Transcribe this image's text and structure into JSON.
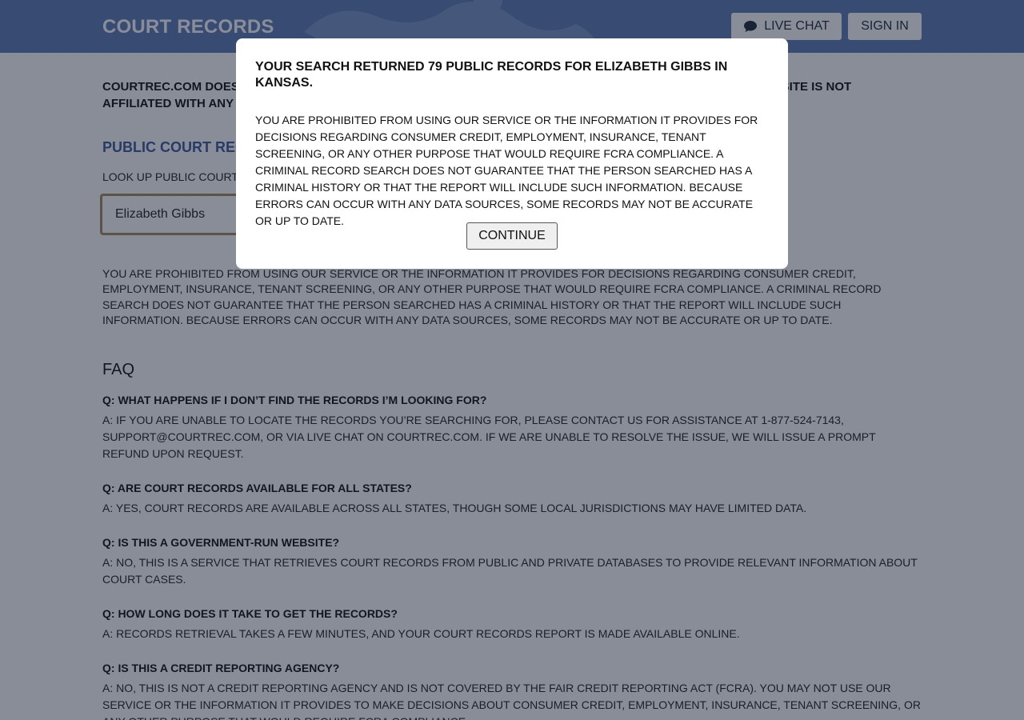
{
  "header": {
    "logo": "COURT RECORDS",
    "live_chat_label": "LIVE CHAT",
    "sign_in_label": "SIGN IN"
  },
  "notice": "COURTREC.COM DOES NOT PROVIDE CONSUMER REPORTS AND IS NOT A CONSUMER REPORTING AGENCY. THIS SITE IS NOT AFFILIATED WITH ANY GOVERNMENT AFFILIATED AGENCY OR CONSUMER REPORTING AGENCY.",
  "search": {
    "section_title": "PUBLIC COURT RECORDS SEARCH",
    "label": "LOOK UP PUBLIC COURTHOUSE RECORDS",
    "value": "Elizabeth Gibbs"
  },
  "disclaimer": "YOU ARE PROHIBITED FROM USING OUR SERVICE OR THE INFORMATION IT PROVIDES FOR DECISIONS REGARDING CONSUMER CREDIT, EMPLOYMENT, INSURANCE, TENANT SCREENING, OR ANY OTHER PURPOSE THAT WOULD REQUIRE FCRA COMPLIANCE. A CRIMINAL RECORD SEARCH DOES NOT GUARANTEE THAT THE PERSON SEARCHED HAS A CRIMINAL HISTORY OR THAT THE REPORT WILL INCLUDE SUCH INFORMATION. BECAUSE ERRORS CAN OCCUR WITH ANY DATA SOURCES, SOME RECORDS MAY NOT BE ACCURATE OR UP TO DATE.",
  "faq": {
    "heading": "FAQ",
    "items": [
      {
        "q": "Q: WHAT HAPPENS IF I DON’T FIND THE RECORDS I’M LOOKING FOR?",
        "a": "A: IF YOU ARE UNABLE TO LOCATE THE RECORDS YOU’RE SEARCHING FOR, PLEASE CONTACT US FOR ASSISTANCE AT 1-877-524-7143, SUPPORT@COURTREC.COM, OR VIA LIVE CHAT ON COURTREC.COM. IF WE ARE UNABLE TO RESOLVE THE ISSUE, WE WILL ISSUE A PROMPT REFUND UPON REQUEST."
      },
      {
        "q": "Q: ARE COURT RECORDS AVAILABLE FOR ALL STATES?",
        "a": "A: YES, COURT RECORDS ARE AVAILABLE ACROSS ALL STATES, THOUGH SOME LOCAL JURISDICTIONS MAY HAVE LIMITED DATA."
      },
      {
        "q": "Q: IS THIS A GOVERNMENT-RUN WEBSITE?",
        "a": "A: NO, THIS IS A SERVICE THAT RETRIEVES COURT RECORDS FROM PUBLIC AND PRIVATE DATABASES TO PROVIDE RELEVANT INFORMATION ABOUT COURT CASES."
      },
      {
        "q": "Q: HOW LONG DOES IT TAKE TO GET THE RECORDS?",
        "a": "A: RECORDS RETRIEVAL TAKES A FEW MINUTES, AND YOUR COURT RECORDS REPORT IS MADE AVAILABLE ONLINE."
      },
      {
        "q": "Q: IS THIS A CREDIT REPORTING AGENCY?",
        "a": "A: NO, THIS IS NOT A CREDIT REPORTING AGENCY AND IS NOT COVERED BY THE FAIR CREDIT REPORTING ACT (FCRA). YOU MAY NOT USE OUR SERVICE OR THE INFORMATION IT PROVIDES TO MAKE DECISIONS ABOUT CONSUMER CREDIT, EMPLOYMENT, INSURANCE, TENANT SCREENING, OR ANY OTHER PURPOSE THAT WOULD REQUIRE FCRA COMPLIANCE."
      }
    ]
  },
  "modal": {
    "title": "YOUR SEARCH RETURNED 79 PUBLIC RECORDS FOR ELIZABETH GIBBS IN KANSAS.",
    "body": "YOU ARE PROHIBITED FROM USING OUR SERVICE OR THE INFORMATION IT PROVIDES FOR DECISIONS REGARDING CONSUMER CREDIT, EMPLOYMENT, INSURANCE, TENANT SCREENING, OR ANY OTHER PURPOSE THAT WOULD REQUIRE FCRA COMPLIANCE. A CRIMINAL RECORD SEARCH DOES NOT GUARANTEE THAT THE PERSON SEARCHED HAS A CRIMINAL HISTORY OR THAT THE REPORT WILL INCLUDE SUCH INFORMATION. BECAUSE ERRORS CAN OCCUR WITH ANY DATA SOURCES, SOME RECORDS MAY NOT BE ACCURATE OR UP TO DATE.",
    "continue_label": "CONTINUE"
  },
  "icons": {
    "chat": "chat-bubble-icon"
  },
  "colors": {
    "header_bg": "#5c7bb5",
    "section_title": "#3c5a9a",
    "input_border": "#a78a5c"
  }
}
